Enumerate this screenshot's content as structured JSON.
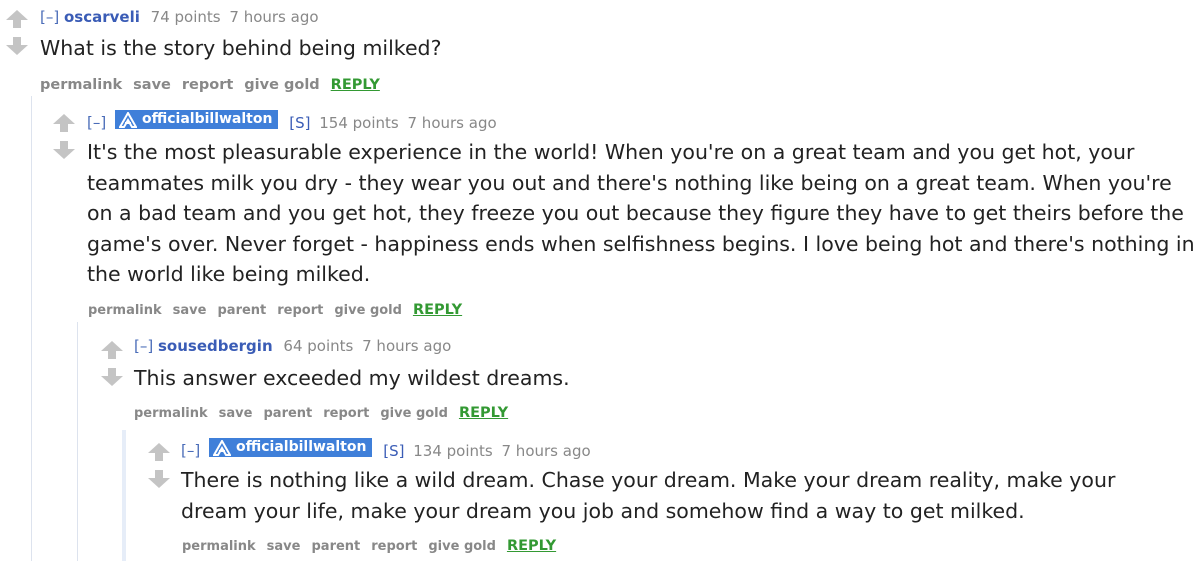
{
  "thread": {
    "comments": [
      {
        "collapse": "[–]",
        "author": "oscarveli",
        "is_op": false,
        "flair": "",
        "points": "74 points",
        "time": "7 hours ago",
        "body": "What is the story behind being milked?",
        "buttons": [
          "permalink",
          "save",
          "report",
          "give gold"
        ],
        "reply": "REPLY"
      },
      {
        "collapse": "[–]",
        "author": "officialbillwalton",
        "is_op": true,
        "flair": "[S]",
        "points": "154 points",
        "time": "7 hours ago",
        "body": "It's the most pleasurable experience in the world! When you're on a great team and you get hot, your teammates milk you dry - they wear you out and there's nothing like being on a great team. When you're on a bad team and you get hot, they freeze you out because they figure they have to get theirs before the game's over. Never forget - happiness ends when selfishness begins. I love being hot and there's nothing in the world like being milked.",
        "buttons": [
          "permalink",
          "save",
          "parent",
          "report",
          "give gold"
        ],
        "reply": "REPLY"
      },
      {
        "collapse": "[–]",
        "author": "sousedbergin",
        "is_op": false,
        "flair": "",
        "points": "64 points",
        "time": "7 hours ago",
        "body": "This answer exceeded my wildest dreams.",
        "buttons": [
          "permalink",
          "save",
          "parent",
          "report",
          "give gold"
        ],
        "reply": "REPLY"
      },
      {
        "collapse": "[–]",
        "author": "officialbillwalton",
        "is_op": true,
        "flair": "[S]",
        "points": "134 points",
        "time": "7 hours ago",
        "body": "There is nothing like a wild dream. Chase your dream. Make your dream reality, make your dream your life, make your dream you job and somehow find a way to get milked.",
        "buttons": [
          "permalink",
          "save",
          "parent",
          "report",
          "give gold"
        ],
        "reply": "REPLY"
      }
    ]
  },
  "colors": {
    "author": "#3a5cb6",
    "op_badge": "#3f7fd9",
    "meta": "#888888",
    "reply": "#339933",
    "arrow": "#c4c4c4"
  },
  "icons": {
    "upvote": "upvote-arrow-icon",
    "downvote": "downvote-arrow-icon",
    "op_logo": "verified-logo-icon"
  }
}
